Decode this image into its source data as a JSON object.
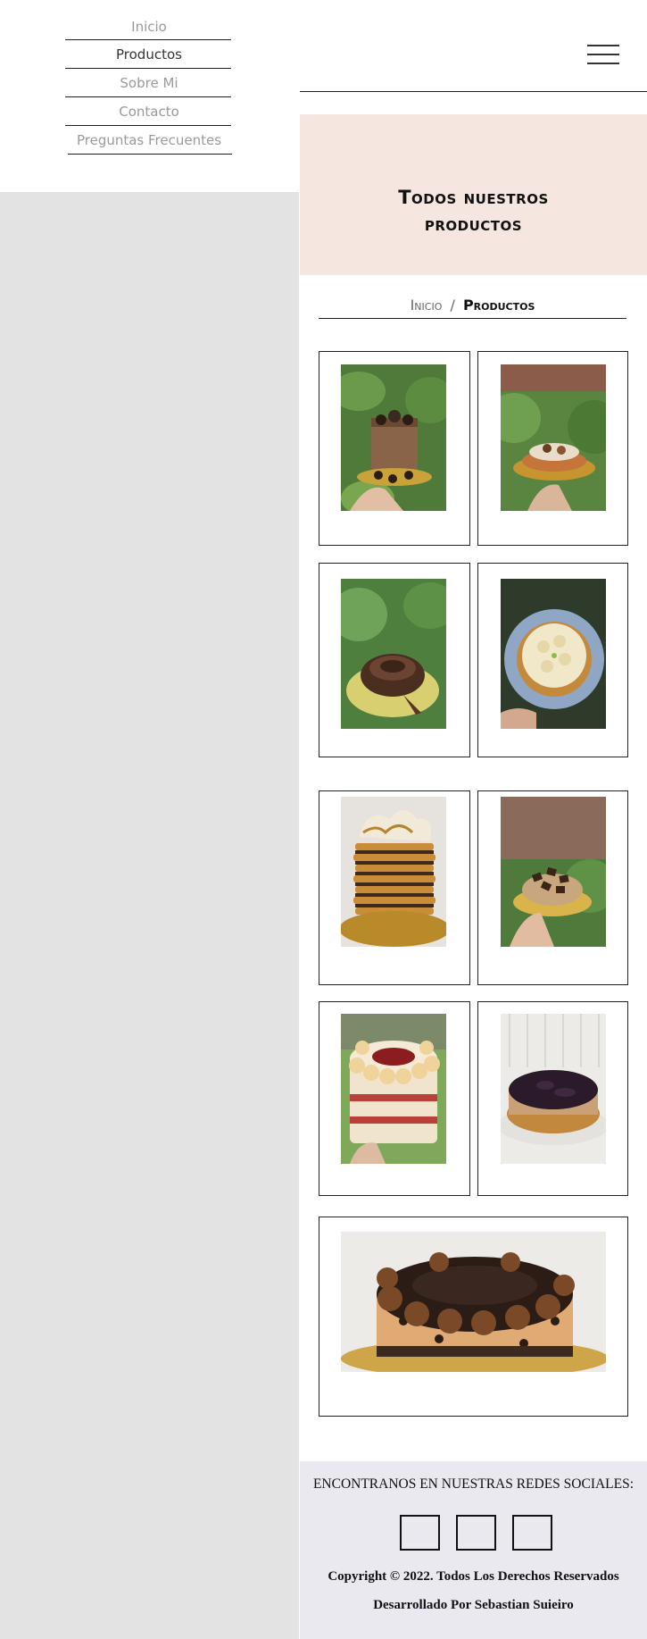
{
  "nav": {
    "items": [
      {
        "label": "Inicio",
        "active": false
      },
      {
        "label": "Productos",
        "active": true
      },
      {
        "label": "Sobre Mi",
        "active": false
      },
      {
        "label": "Contacto",
        "active": false
      },
      {
        "label": "Preguntas Frecuentes",
        "active": false
      }
    ]
  },
  "header": {
    "menu_icon": "hamburger-icon"
  },
  "hero": {
    "title_line1": "Todos nuestros",
    "title_line2": "productos"
  },
  "breadcrumb": {
    "home": "Inicio",
    "separator": "/",
    "current": "Productos"
  },
  "products": [
    {
      "image": "chocolate drip cake with cookies"
    },
    {
      "image": "tart with cream and caramel"
    },
    {
      "image": "chocolate mousse cake"
    },
    {
      "image": "lemon meringue pie"
    },
    {
      "image": "rogel layered meringue cake"
    },
    {
      "image": "chocolate cheesecake with chocolate bars"
    },
    {
      "image": "red velvet cake with cream rosettes"
    },
    {
      "image": "chocolate cheesecake with ganache"
    },
    {
      "image": "oreo cake with chocolate rosettes"
    }
  ],
  "footer": {
    "heading": "ENCONTRANOS EN NUESTRAS REDES SOCIALES:",
    "social_icons": [
      "social-icon-1",
      "social-icon-2",
      "social-icon-3"
    ],
    "copyright": "Copyright © 2022. Todos Los Derechos Reservados",
    "developed_by": "Desarrollado Por Sebastian Suieiro"
  },
  "colors": {
    "hero_background": "#f5e6e0",
    "left_panel": "#e3e3e4",
    "footer_background": "#e9e9ef",
    "nav_inactive": "#9a9a9a",
    "nav_active": "#333333"
  }
}
